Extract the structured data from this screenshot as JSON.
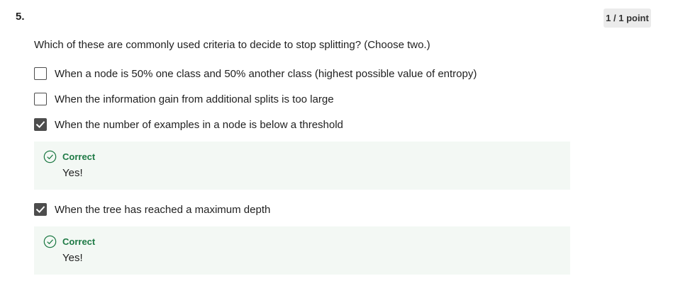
{
  "question": {
    "number": "5.",
    "points": "1 / 1 point",
    "prompt": "Which of these are commonly used criteria to decide to stop splitting? (Choose two.)"
  },
  "options": [
    {
      "label": "When a node is 50% one class and 50% another class (highest possible value of entropy)",
      "checked": false
    },
    {
      "label": "When the information gain from additional splits is too large",
      "checked": false
    },
    {
      "label": "When the number of examples in a node is below a threshold",
      "checked": true
    },
    {
      "label": "When the tree has reached a maximum depth",
      "checked": true
    }
  ],
  "feedback": [
    {
      "status": "Correct",
      "message": "Yes!"
    },
    {
      "status": "Correct",
      "message": "Yes!"
    }
  ],
  "colors": {
    "correct_green": "#1e7a45",
    "feedback_bg": "#f3f8f4",
    "checkbox_checked": "#4d4d4d",
    "badge_bg": "#ebebeb"
  },
  "icons": {
    "checkmark": "check-icon",
    "correct": "check-circle-icon"
  }
}
